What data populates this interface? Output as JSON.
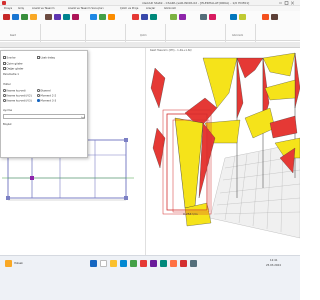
{
  "window": {
    "title": "ideCAD Statik - CSAPA (sAR-INCIR-02 - [ELERHALAT(ORKA) - 1/0 HCE01]"
  },
  "menu": {
    "items": [
      "Dosya",
      "Giriş",
      "Analiz ve Tasarım",
      "Analiz ve Tasarım Sonuçları",
      "Çizim ve Proje",
      "Araçlar",
      "Görünüm"
    ]
  },
  "ribbon": {
    "groups": [
      "Kesit",
      "Çizim",
      "Görünüm"
    ]
  },
  "dialog": {
    "rows": [
      "Sınırlar",
      "Çizim göster",
      "Değer göster",
      "Parametre 1"
    ],
    "label_left": "Yükler",
    "option_right_top": "Uzak detay",
    "options_left": [
      "Kesme kuvveti",
      "Kesme kuvveti (V2)",
      "Kesme kuvveti (V3)"
    ],
    "options_right": [
      "Eksenel",
      "Moment 2-2",
      "Moment 3-3"
    ],
    "dropdown_label": "Ayırma",
    "footer": "Boşluk"
  },
  "view3d": {
    "title": "Kesit Tasarımı (M3) - 1.4G+1.6Q",
    "moment_label": "0.254 t/m"
  },
  "taskbar": {
    "weather": "Yüksek",
    "time": "12:41",
    "date": "25.03.2024"
  },
  "colors": {
    "diagram_yellow": "#f5e31a",
    "diagram_red": "#e53935",
    "selection_red": "#d32f2f",
    "grid_blue": "#7b7fc4",
    "accent": "#1565c0"
  }
}
